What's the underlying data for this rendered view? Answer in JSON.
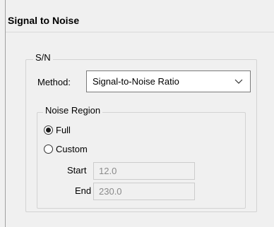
{
  "header": {
    "title": "Signal to Noise"
  },
  "sn_group": {
    "label": "S/N",
    "method": {
      "label": "Method:",
      "selected": "Signal-to-Noise Ratio",
      "dropdown_icon": "chevron-down-icon"
    }
  },
  "noise_region": {
    "label": "Noise Region",
    "options": [
      {
        "label": "Full",
        "checked": true
      },
      {
        "label": "Custom",
        "checked": false
      }
    ],
    "start": {
      "label": "Start",
      "value": "12.0"
    },
    "end": {
      "label": "End",
      "value": "230.0"
    }
  }
}
